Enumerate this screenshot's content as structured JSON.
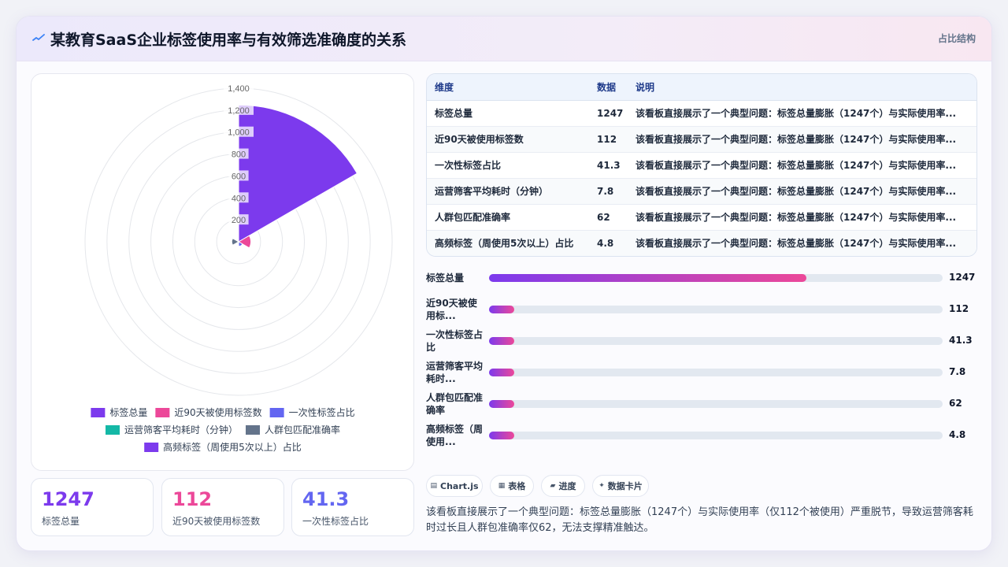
{
  "header": {
    "title": "某教育SaaS企业标签使用率与有效筛选准确度的关系",
    "tag": "占比结构",
    "logo_icon": "sparkline-icon"
  },
  "chart_data": {
    "type": "polarArea",
    "categories": [
      "标签总量",
      "近90天被使用标签数",
      "一次性标签占比",
      "运营筛客平均耗时（分钟）",
      "人群包匹配准确率",
      "高频标签（周使用5次以上）占比"
    ],
    "values": [
      1247,
      112,
      41.3,
      7.8,
      62,
      4.8
    ],
    "colors": [
      "#7c3aed",
      "#ec4899",
      "#6366f1",
      "#14b8a6",
      "#64748b",
      "#7c3aed"
    ],
    "rlim": [
      0,
      1400
    ],
    "ticks": [
      "200",
      "400",
      "600",
      "800",
      "1,000",
      "1,200",
      "1,400"
    ],
    "legend_position": "bottom"
  },
  "kpis": [
    {
      "value": "1247",
      "label": "标签总量",
      "color": "#7c3aed"
    },
    {
      "value": "112",
      "label": "近90天被使用标签数",
      "color": "#ec4899"
    },
    {
      "value": "41.3",
      "label": "一次性标签占比",
      "color": "#6366f1"
    }
  ],
  "table": {
    "headers": [
      "维度",
      "数据",
      "说明"
    ],
    "rows": [
      [
        "标签总量",
        "1247",
        "该看板直接展示了一个典型问题：标签总量膨胀（1247个）与实际使用率..."
      ],
      [
        "近90天被使用标签数",
        "112",
        "该看板直接展示了一个典型问题：标签总量膨胀（1247个）与实际使用率..."
      ],
      [
        "一次性标签占比",
        "41.3",
        "该看板直接展示了一个典型问题：标签总量膨胀（1247个）与实际使用率..."
      ],
      [
        "运营筛客平均耗时（分钟）",
        "7.8",
        "该看板直接展示了一个典型问题：标签总量膨胀（1247个）与实际使用率..."
      ],
      [
        "人群包匹配准确率",
        "62",
        "该看板直接展示了一个典型问题：标签总量膨胀（1247个）与实际使用率..."
      ],
      [
        "高频标签（周使用5次以上）占比",
        "4.8",
        "该看板直接展示了一个典型问题：标签总量膨胀（1247个）与实际使用率..."
      ]
    ]
  },
  "bars": [
    {
      "label": "标签总量",
      "value": "1247",
      "fill": 0.7
    },
    {
      "label": "近90天被使\n用标...",
      "value": "112",
      "fill": 0.055
    },
    {
      "label": "一次性标签占\n比",
      "value": "41.3",
      "fill": 0.055
    },
    {
      "label": "运营筛客平均\n耗时...",
      "value": "7.8",
      "fill": 0.055
    },
    {
      "label": "人群包匹配准\n确率",
      "value": "62",
      "fill": 0.055
    },
    {
      "label": "高频标签（周\n使用...",
      "value": "4.8",
      "fill": 0.055
    }
  ],
  "chips": [
    {
      "icon": "▤",
      "label": "Chart.js"
    },
    {
      "icon": "▦",
      "label": "表格"
    },
    {
      "icon": "▰",
      "label": "进度"
    },
    {
      "icon": "✦",
      "label": "数据卡片"
    }
  ],
  "description": "该看板直接展示了一个典型问题：标签总量膨胀（1247个）与实际使用率（仅112个被使用）严重脱节，导致运营筛客耗时过长且人群包准确率仅62，无法支撑精准触达。"
}
